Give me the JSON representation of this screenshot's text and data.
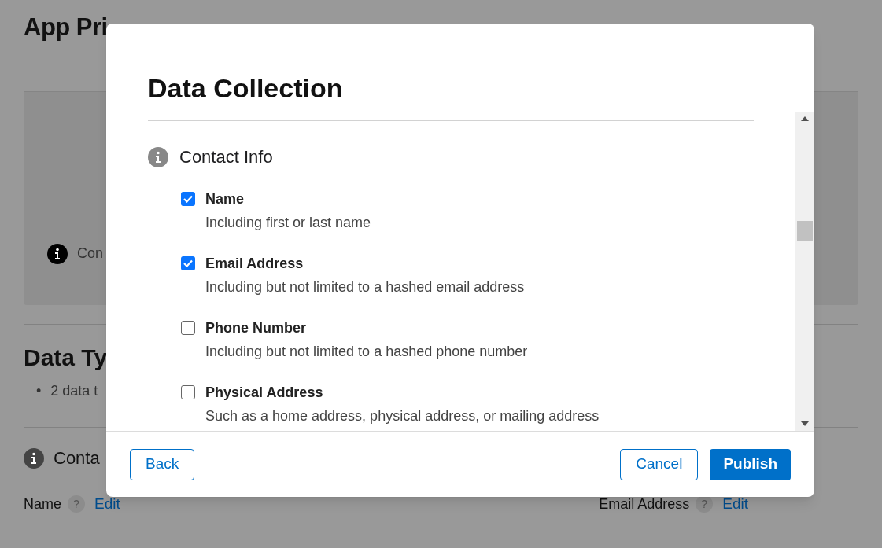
{
  "background": {
    "title": "App Pri",
    "notice": "Con",
    "section_title": "Data Ty",
    "bullets": [
      {
        "marker": "•",
        "text": "2 data t"
      }
    ],
    "category": "Conta",
    "fields": [
      {
        "label": "Name",
        "help": "?",
        "action": "Edit"
      },
      {
        "label": "Email Address",
        "help": "?",
        "action": "Edit"
      }
    ]
  },
  "dialog": {
    "title": "Data Collection",
    "section": "Contact Info",
    "items": [
      {
        "label": "Name",
        "description": "Including first or last name",
        "checked": true
      },
      {
        "label": "Email Address",
        "description": "Including but not limited to a hashed email address",
        "checked": true
      },
      {
        "label": "Phone Number",
        "description": "Including but not limited to a hashed phone number",
        "checked": false
      },
      {
        "label": "Physical Address",
        "description": "Such as a home address, physical address, or mailing address",
        "checked": false
      }
    ],
    "buttons": [
      {
        "label": "Back",
        "kind": "secondary"
      },
      {
        "label": "Cancel",
        "kind": "secondary"
      },
      {
        "label": "Publish",
        "kind": "primary"
      }
    ]
  }
}
